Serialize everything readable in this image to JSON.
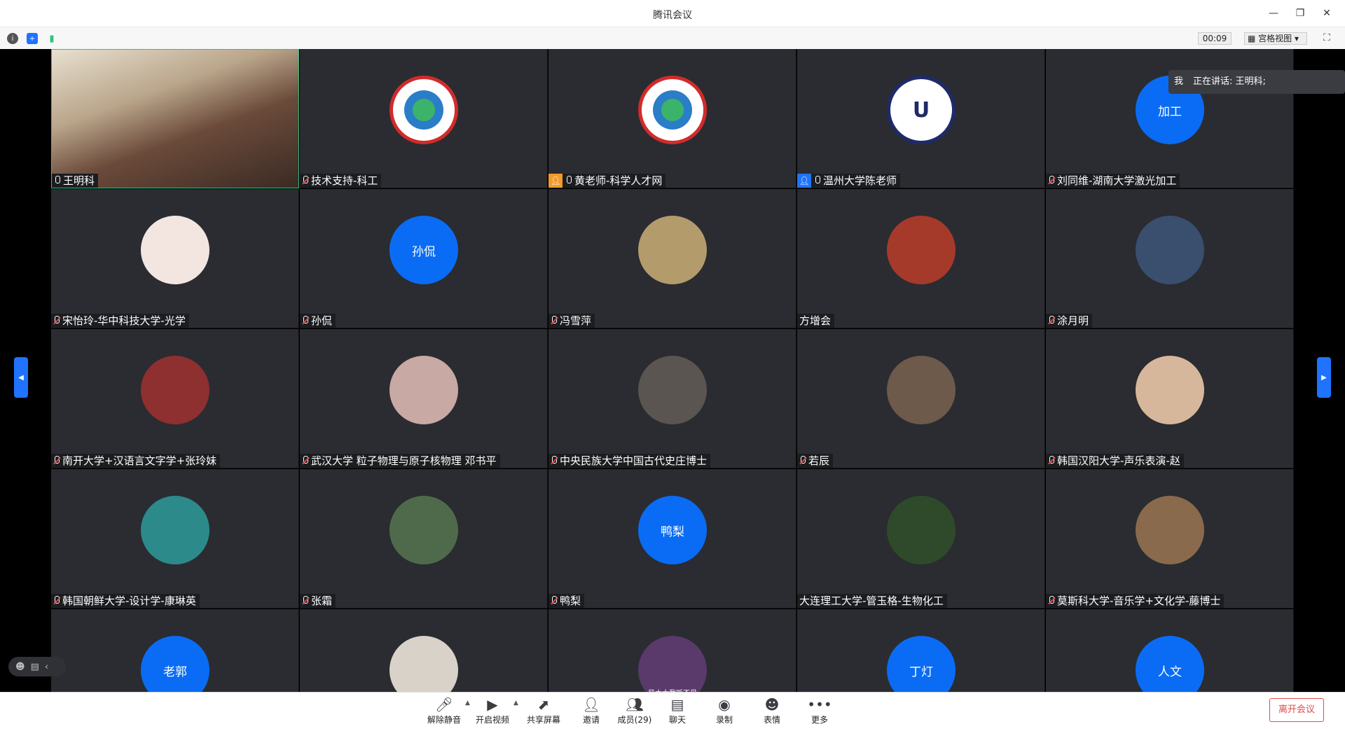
{
  "window": {
    "title": "腾讯会议"
  },
  "topbar": {
    "timer": "00:09",
    "view_mode": "宫格视图"
  },
  "speaker_popup": {
    "me": "我",
    "speaking": "正在讲话: 王明科;"
  },
  "tiles": [
    {
      "name": "王明科",
      "type": "video",
      "mic": "on",
      "badge": ""
    },
    {
      "name": "技术支持-科工",
      "type": "logo-red",
      "mic": "muted",
      "badge": ""
    },
    {
      "name": "黄老师-科学人才网",
      "type": "logo-red",
      "mic": "on",
      "badge": "orange"
    },
    {
      "name": "温州大学陈老师",
      "type": "logo-navy",
      "mic": "on",
      "badge": "blue"
    },
    {
      "name": "刘同维-湖南大学激光加工",
      "type": "blue",
      "text": "加工",
      "mic": "muted",
      "badge": ""
    },
    {
      "name": "宋怡玲-华中科技大学-光学",
      "type": "photo",
      "color": "#f3e6e0",
      "mic": "muted",
      "badge": ""
    },
    {
      "name": "孙侃",
      "type": "blue",
      "text": "孙侃",
      "mic": "muted",
      "badge": ""
    },
    {
      "name": "冯雪萍",
      "type": "photo",
      "color": "#b39b6c",
      "mic": "muted",
      "badge": ""
    },
    {
      "name": "方增会",
      "type": "photo",
      "color": "#a63a2a",
      "mic": "none",
      "badge": ""
    },
    {
      "name": "涂月明",
      "type": "photo",
      "color": "#3a4e6e",
      "mic": "muted",
      "badge": ""
    },
    {
      "name": "南开大学+汉语言文字学+张玲妹",
      "type": "photo",
      "color": "#8e2f30",
      "mic": "muted",
      "badge": ""
    },
    {
      "name": "武汉大学 粒子物理与原子核物理 邓书平",
      "type": "photo",
      "color": "#c9a9a4",
      "mic": "muted",
      "badge": ""
    },
    {
      "name": "中央民族大学中国古代史庄博士",
      "type": "photo",
      "color": "#5a5550",
      "mic": "muted",
      "badge": ""
    },
    {
      "name": "若辰",
      "type": "photo",
      "color": "#6d5a4a",
      "mic": "muted",
      "badge": ""
    },
    {
      "name": "韩国汉阳大学-声乐表演-赵",
      "type": "photo",
      "color": "#d7b79c",
      "mic": "muted",
      "badge": ""
    },
    {
      "name": "韩国朝鲜大学-设计学-康琳英",
      "type": "photo",
      "color": "#2c8a8a",
      "mic": "muted",
      "badge": ""
    },
    {
      "name": "张霜",
      "type": "photo",
      "color": "#4f6a4a",
      "mic": "muted",
      "badge": ""
    },
    {
      "name": "鸭梨",
      "type": "blue",
      "text": "鸭梨",
      "mic": "muted",
      "badge": ""
    },
    {
      "name": "大连理工大学-管玉格-生物化工",
      "type": "photo",
      "color": "#2e4a2a",
      "mic": "none",
      "badge": ""
    },
    {
      "name": "莫斯科大学-音乐学+文化学-藤博士",
      "type": "photo",
      "color": "#8a6a4c",
      "mic": "muted",
      "badge": ""
    },
    {
      "name": "",
      "type": "blue",
      "text": "老郭",
      "mic": "none",
      "badge": ""
    },
    {
      "name": "",
      "type": "photo",
      "color": "#d9d2c9",
      "mic": "none",
      "badge": ""
    },
    {
      "name": "",
      "type": "photo",
      "color": "#5a3a6a",
      "text": "风太大我听不见",
      "mic": "none",
      "badge": ""
    },
    {
      "name": "",
      "type": "blue",
      "text": "丁灯",
      "mic": "none",
      "badge": ""
    },
    {
      "name": "",
      "type": "blue",
      "text": "人文",
      "mic": "none",
      "badge": ""
    }
  ],
  "toolbar": {
    "unmute": "解除静音",
    "video": "开启视频",
    "share": "共享屏幕",
    "invite": "邀请",
    "members": "成员(29)",
    "chat": "聊天",
    "record": "录制",
    "emoji": "表情",
    "more": "更多",
    "leave": "离开会议"
  }
}
